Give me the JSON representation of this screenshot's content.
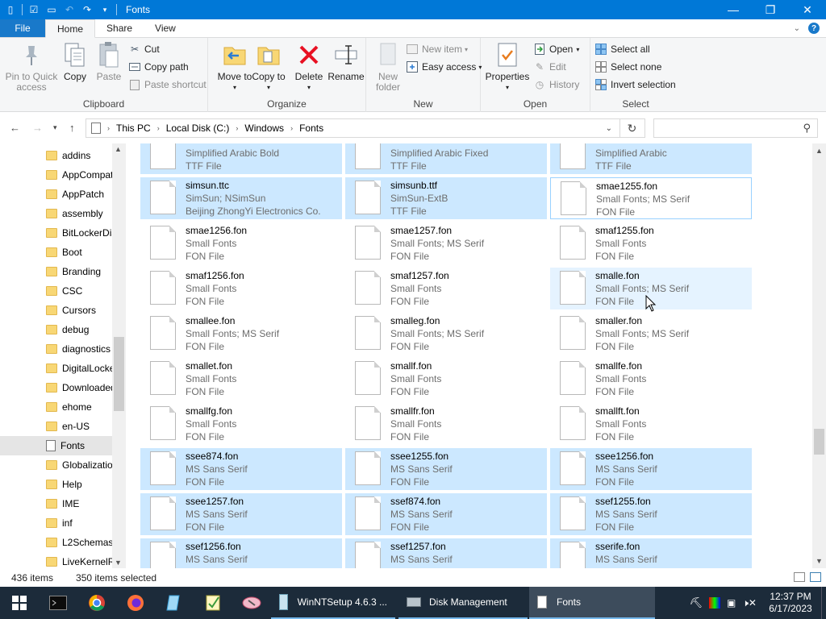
{
  "window": {
    "title": "Fonts",
    "controls": {
      "minimize": "—",
      "maximize": "❐",
      "close": "✕"
    }
  },
  "tabs": [
    "File",
    "Home",
    "Share",
    "View"
  ],
  "ribbon": {
    "clipboard": {
      "label": "Clipboard",
      "pin": "Pin to Quick access",
      "copy": "Copy",
      "paste": "Paste",
      "cut": "Cut",
      "copy_path": "Copy path",
      "paste_shortcut": "Paste shortcut"
    },
    "organize": {
      "label": "Organize",
      "move_to": "Move to",
      "copy_to": "Copy to",
      "delete": "Delete",
      "rename": "Rename"
    },
    "new": {
      "label": "New",
      "new_folder": "New folder",
      "new_item": "New item",
      "easy_access": "Easy access"
    },
    "open": {
      "label": "Open",
      "properties": "Properties",
      "open": "Open",
      "edit": "Edit",
      "history": "History"
    },
    "select": {
      "label": "Select",
      "select_all": "Select all",
      "select_none": "Select none",
      "invert": "Invert selection"
    }
  },
  "address": {
    "crumbs": [
      "This PC",
      "Local Disk (C:)",
      "Windows",
      "Fonts"
    ],
    "search_placeholder": ""
  },
  "nav": {
    "items": [
      "addins",
      "AppCompat",
      "AppPatch",
      "assembly",
      "BitLockerDiscovery",
      "Boot",
      "Branding",
      "CSC",
      "Cursors",
      "debug",
      "diagnostics",
      "DigitalLocker",
      "Downloaded",
      "ehome",
      "en-US",
      "Fonts",
      "Globalization",
      "Help",
      "IME",
      "inf",
      "L2Schemas",
      "LiveKernelReports"
    ],
    "selected": 15
  },
  "files": [
    {
      "name": "",
      "l2": "Simplified Arabic Bold",
      "l3": "TTF File",
      "state": "selected"
    },
    {
      "name": "",
      "l2": "Simplified Arabic Fixed",
      "l3": "TTF File",
      "state": "selected"
    },
    {
      "name": "",
      "l2": "Simplified Arabic",
      "l3": "TTF File",
      "state": "selected"
    },
    {
      "name": "simsun.ttc",
      "l2": "SimSun; NSimSun",
      "l3": "Beijing ZhongYi Electronics Co.",
      "state": "selected"
    },
    {
      "name": "simsunb.ttf",
      "l2": "SimSun-ExtB",
      "l3": "TTF File",
      "state": "selected"
    },
    {
      "name": "smae1255.fon",
      "l2": "Small Fonts; MS Serif",
      "l3": "FON File",
      "state": "focus"
    },
    {
      "name": "smae1256.fon",
      "l2": "Small Fonts",
      "l3": "FON File",
      "state": ""
    },
    {
      "name": "smae1257.fon",
      "l2": "Small Fonts; MS Serif",
      "l3": "FON File",
      "state": ""
    },
    {
      "name": "smaf1255.fon",
      "l2": "Small Fonts",
      "l3": "FON File",
      "state": ""
    },
    {
      "name": "smaf1256.fon",
      "l2": "Small Fonts",
      "l3": "FON File",
      "state": ""
    },
    {
      "name": "smaf1257.fon",
      "l2": "Small Fonts",
      "l3": "FON File",
      "state": ""
    },
    {
      "name": "smalle.fon",
      "l2": "Small Fonts; MS Serif",
      "l3": "FON File",
      "state": "hover"
    },
    {
      "name": "smallee.fon",
      "l2": "Small Fonts; MS Serif",
      "l3": "FON File",
      "state": ""
    },
    {
      "name": "smalleg.fon",
      "l2": "Small Fonts; MS Serif",
      "l3": "FON File",
      "state": ""
    },
    {
      "name": "smaller.fon",
      "l2": "Small Fonts; MS Serif",
      "l3": "FON File",
      "state": ""
    },
    {
      "name": "smallet.fon",
      "l2": "Small Fonts",
      "l3": "FON File",
      "state": ""
    },
    {
      "name": "smallf.fon",
      "l2": "Small Fonts",
      "l3": "FON File",
      "state": ""
    },
    {
      "name": "smallfe.fon",
      "l2": "Small Fonts",
      "l3": "FON File",
      "state": ""
    },
    {
      "name": "smallfg.fon",
      "l2": "Small Fonts",
      "l3": "FON File",
      "state": ""
    },
    {
      "name": "smallfr.fon",
      "l2": "Small Fonts",
      "l3": "FON File",
      "state": ""
    },
    {
      "name": "smallft.fon",
      "l2": "Small Fonts",
      "l3": "FON File",
      "state": ""
    },
    {
      "name": "ssee874.fon",
      "l2": "MS Sans Serif",
      "l3": "FON File",
      "state": "selected"
    },
    {
      "name": "ssee1255.fon",
      "l2": "MS Sans Serif",
      "l3": "FON File",
      "state": "selected"
    },
    {
      "name": "ssee1256.fon",
      "l2": "MS Sans Serif",
      "l3": "FON File",
      "state": "selected"
    },
    {
      "name": "ssee1257.fon",
      "l2": "MS Sans Serif",
      "l3": "FON File",
      "state": "selected"
    },
    {
      "name": "ssef874.fon",
      "l2": "MS Sans Serif",
      "l3": "FON File",
      "state": "selected"
    },
    {
      "name": "ssef1255.fon",
      "l2": "MS Sans Serif",
      "l3": "FON File",
      "state": "selected"
    },
    {
      "name": "ssef1256.fon",
      "l2": "MS Sans Serif",
      "l3": "",
      "state": "selected"
    },
    {
      "name": "ssef1257.fon",
      "l2": "MS Sans Serif",
      "l3": "",
      "state": "selected"
    },
    {
      "name": "sserife.fon",
      "l2": "MS Sans Serif",
      "l3": "",
      "state": "selected"
    }
  ],
  "status": {
    "items": "436 items",
    "selected": "350 items selected"
  },
  "taskbar": {
    "apps": [
      {
        "label": "WinNTSetup 4.6.3 ...",
        "active": false
      },
      {
        "label": "Disk Management",
        "active": false
      },
      {
        "label": "Fonts",
        "active": true
      }
    ],
    "time": "12:37 PM",
    "date": "6/17/2023"
  }
}
